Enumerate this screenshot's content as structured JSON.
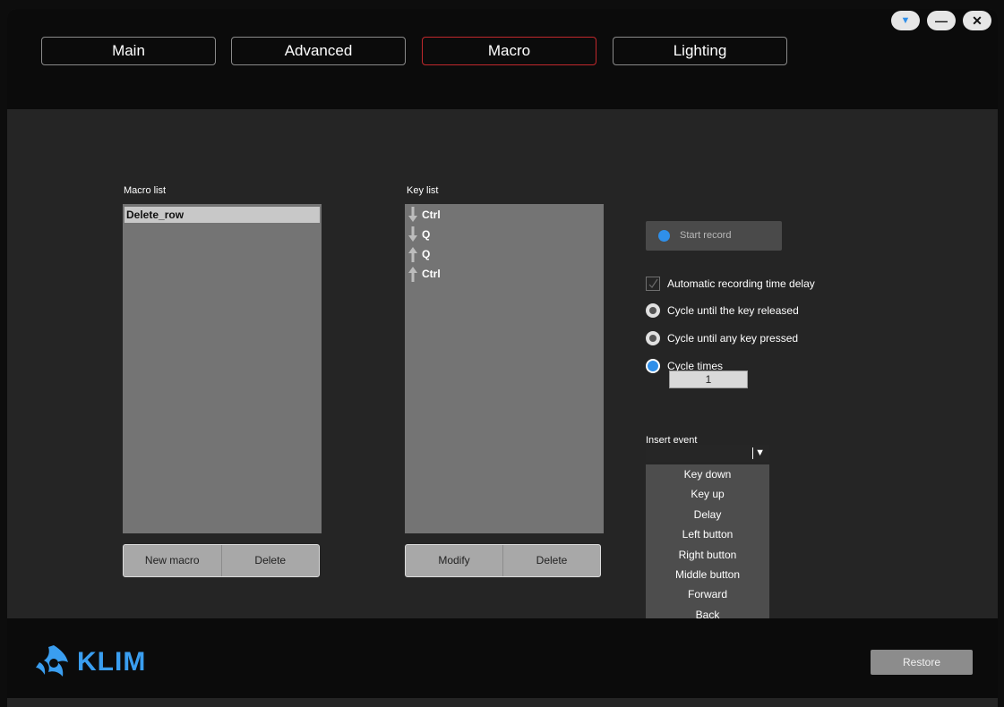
{
  "tabs": [
    {
      "label": "Main",
      "active": false
    },
    {
      "label": "Advanced",
      "active": false
    },
    {
      "label": "Macro",
      "active": true
    },
    {
      "label": "Lighting",
      "active": false
    }
  ],
  "window_controls": {
    "menu": "▼",
    "minimize": "—",
    "close": "✕"
  },
  "macro_list": {
    "label": "Macro list",
    "items": [
      "Delete_row"
    ],
    "selected_index": 0,
    "buttons": {
      "new": "New macro",
      "delete": "Delete"
    }
  },
  "key_list": {
    "label": "Key list",
    "items": [
      {
        "key": "Ctrl",
        "direction": "down"
      },
      {
        "key": "Q",
        "direction": "down"
      },
      {
        "key": "Q",
        "direction": "up"
      },
      {
        "key": "Ctrl",
        "direction": "up"
      }
    ],
    "buttons": {
      "modify": "Modify",
      "delete": "Delete"
    }
  },
  "record": {
    "label": "Start record"
  },
  "options": {
    "auto_delay": {
      "label": "Automatic recording time delay",
      "checked": true
    },
    "cycle_release": {
      "label": "Cycle until the key released",
      "selected": false
    },
    "cycle_any_key": {
      "label": "Cycle until any key pressed",
      "selected": false
    },
    "cycle_times": {
      "label": "Cycle times",
      "selected": true,
      "value": "1"
    }
  },
  "insert_event": {
    "label": "Insert event",
    "arrow": "▼",
    "options": [
      "Key down",
      "Key up",
      "Delay",
      "Left button",
      "Right button",
      "Middle button",
      "Forward",
      "Back"
    ]
  },
  "footer": {
    "brand": "KLIM",
    "restore": "Restore"
  },
  "colors": {
    "accent_blue": "#2f8fe9",
    "active_tab_border": "#c0282c",
    "logo_blue": "#3a9ef0"
  }
}
